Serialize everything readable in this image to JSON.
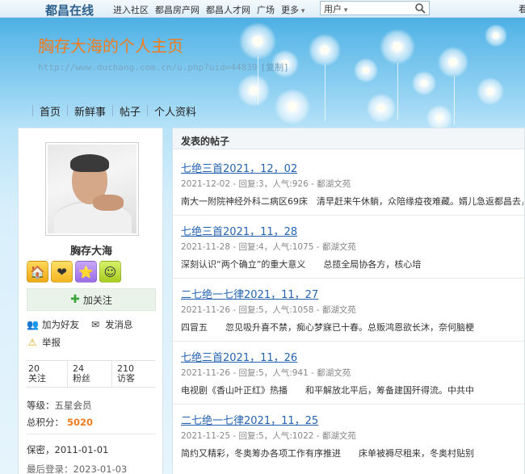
{
  "topbar": {
    "logo": "都昌在线",
    "links": [
      "进入社区",
      "都昌房产网",
      "都昌人才网",
      "广场"
    ],
    "more": "更多",
    "search_scope": "用户",
    "right_char": "看"
  },
  "site": {
    "title": "胸存大海的个人主页",
    "url": "http://www.duchang.com.cn/u.php?uid=44839",
    "copy_label": "[复制]"
  },
  "nav": [
    "首页",
    "新鲜事",
    "帖子",
    "个人资料"
  ],
  "profile": {
    "name": "胸存大海",
    "follow_label": "加关注",
    "add_friend": "加为好友",
    "send_message": "发消息",
    "report": "举报",
    "stats": [
      {
        "num": "20",
        "label": "关注"
      },
      {
        "num": "24",
        "label": "粉丝"
      },
      {
        "num": "210",
        "label": "访客"
      }
    ],
    "level_label": "等级：",
    "level_value": "五星会员",
    "points_label": "总积分：",
    "points_value": "5020",
    "privacy": "保密，2011-01-01",
    "last_login": "最后登录：2023-01-03"
  },
  "posts_section": {
    "heading": "发表的帖子",
    "posts": [
      {
        "title": "七绝三首2021，12，02",
        "meta": "2021-12-02 - 回复:3，人气:926 - 鄱湖文苑",
        "excerpt": "南大一附院神经外科二病区69床　清早赶来午休躺，众陪缘疫夜难藏。婿儿急返都昌去，"
      },
      {
        "title": "七绝三首2021，11，28",
        "meta": "2021-11-28 - 回复:4，人气:1075 - 鄱湖文苑",
        "excerpt": "深刻认识“两个确立”的重大意义　　总揽全局协各方，核心培"
      },
      {
        "title": "二七绝一七律2021，11，27",
        "meta": "2021-11-26 - 回复:5，人气:1058 - 鄱湖文苑",
        "excerpt": "四冒五　　忽见吸升喜不禁，痴心梦寐已十春。总贩鸿恩欲长沐，奈何脑梗"
      },
      {
        "title": "七绝三首2021，11，26",
        "meta": "2021-11-26 - 回复:5，人气:941 - 鄱湖文苑",
        "excerpt": "电视剧《香山叶正红》热播　　和平解放北平后，筹备建国歼得流。中共中"
      },
      {
        "title": "二七绝一七律2021，11，25",
        "meta": "2021-11-25 - 回复:5，人气:1022 - 鄱湖文苑",
        "excerpt": "简约又精彩，冬奥筹办各项工作有序推进　　床单被褥尽租来，冬奥村贴别"
      }
    ]
  }
}
